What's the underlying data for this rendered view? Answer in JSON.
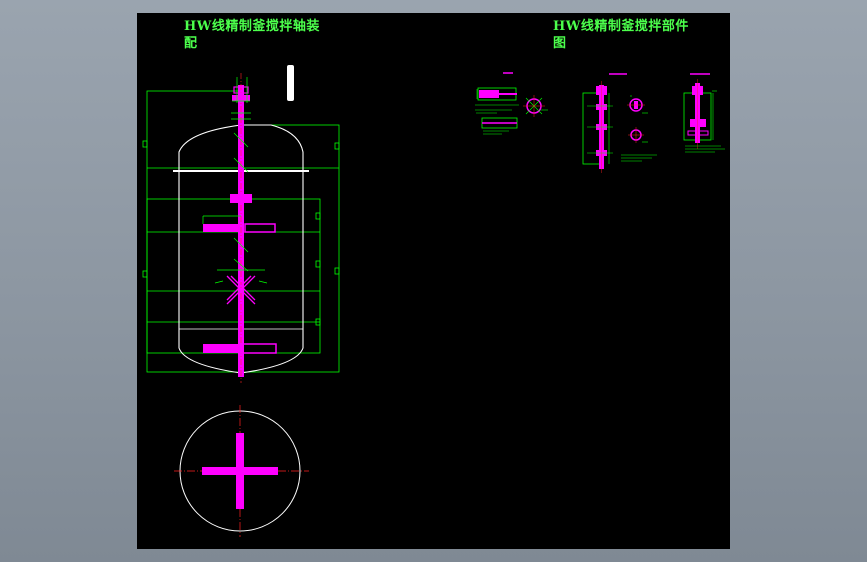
{
  "colors": {
    "background": "#9aa4af",
    "canvas": "#000000",
    "outline": "#00ff00",
    "part": "#ff00ff",
    "linework": "#ffffff",
    "centerline": "#ff2020"
  },
  "drawing": {
    "title_left": {
      "line1": "HW线精制釜搅拌轴装",
      "line2": "配"
    },
    "title_right": {
      "line1": "HW线精制釜搅拌部件",
      "line2": "图"
    }
  }
}
